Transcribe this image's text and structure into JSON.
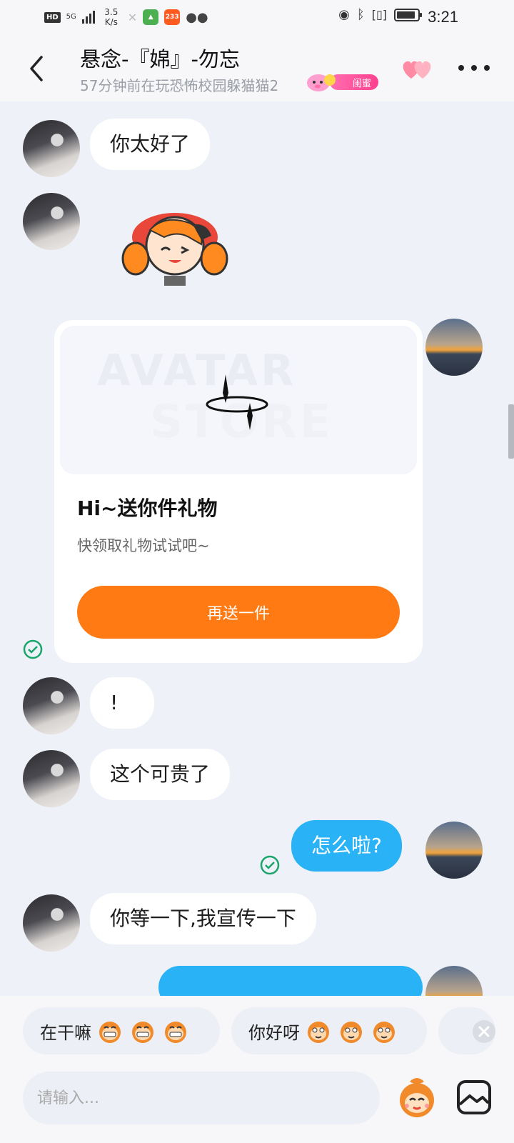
{
  "status_bar": {
    "hd": "HD",
    "network": "5G",
    "speed": "3.5\nK/s",
    "app_badge": "233",
    "time": "3:21"
  },
  "header": {
    "title": "悬念-『婂』-勿忘",
    "subtitle": "57分钟前在玩恐怖校园躲猫猫2",
    "relation_badge": "闺蜜"
  },
  "messages": [
    {
      "side": "in",
      "type": "text",
      "text": "你太好了"
    },
    {
      "side": "in",
      "type": "sticker",
      "sticker": "girl-sticker"
    },
    {
      "side": "out",
      "type": "gift_card",
      "watermark_top": "AVATAR",
      "watermark_bottom": "STORE",
      "title": "Hi~送你件礼物",
      "subtitle": "快领取礼物试试吧~",
      "button": "再送一件",
      "status": "read"
    },
    {
      "side": "in",
      "type": "text",
      "text": "!"
    },
    {
      "side": "in",
      "type": "text",
      "text": "这个可贵了"
    },
    {
      "side": "out",
      "type": "text",
      "text": "怎么啦?",
      "status": "read"
    },
    {
      "side": "in",
      "type": "text",
      "text": "你等一下,我宣传一下"
    }
  ],
  "quick_replies": [
    {
      "text": "在干嘛",
      "icon": "laughing-monkey-icon"
    },
    {
      "text": "你好呀",
      "icon": "monkey-face-icon"
    }
  ],
  "input": {
    "placeholder": "请输入..."
  },
  "colors": {
    "outgoing_bubble": "#29b3f6",
    "accent_button": "#ff7a12",
    "background": "#eef1f8",
    "read_tick": "#1aa56b"
  }
}
